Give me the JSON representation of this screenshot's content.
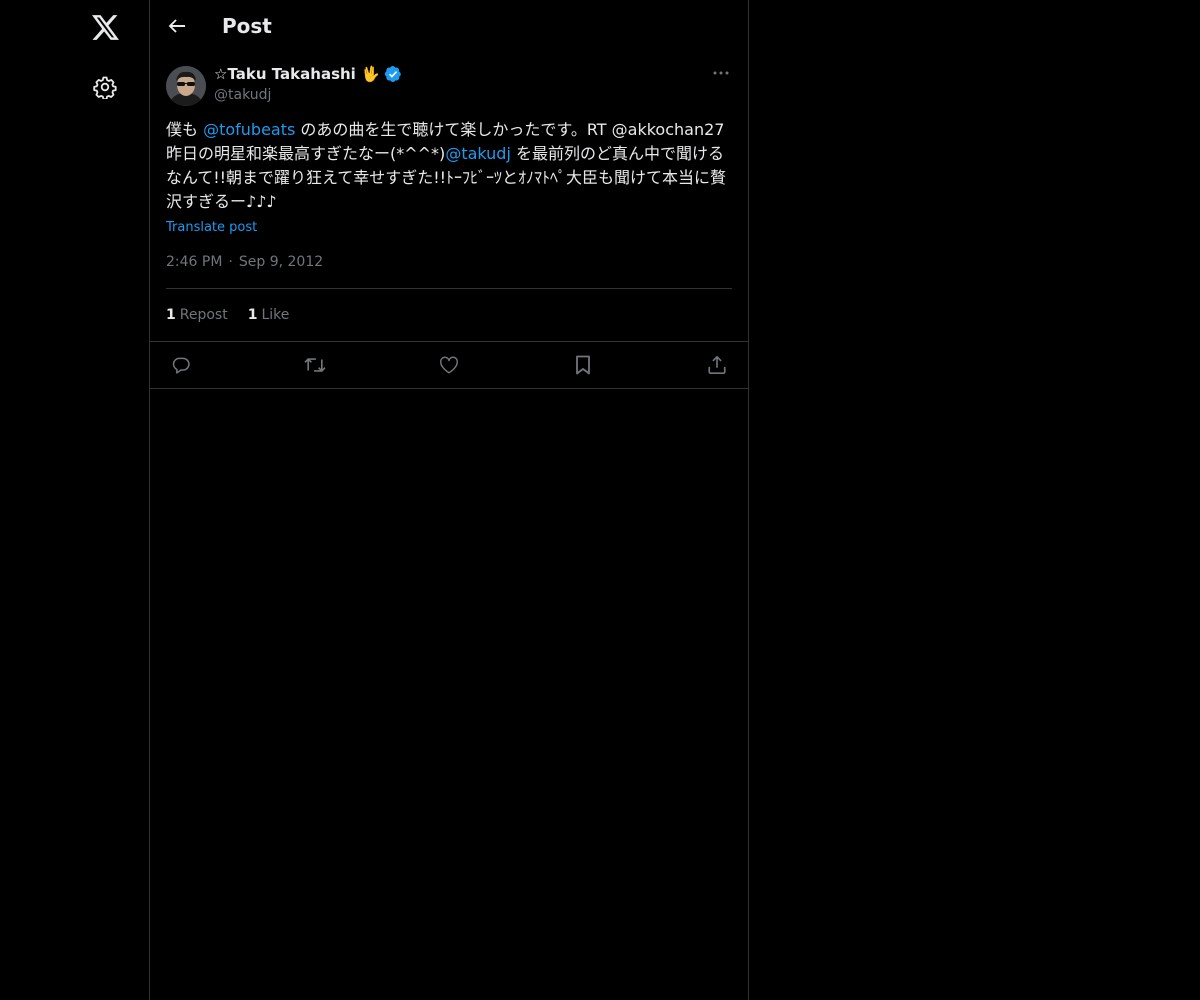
{
  "header": {
    "title": "Post"
  },
  "post": {
    "author": {
      "display_name": "☆Taku Takahashi 🖖",
      "handle": "@takudj",
      "verified": true
    },
    "text_parts": [
      {
        "type": "text",
        "value": "僕も "
      },
      {
        "type": "mention",
        "value": "@tofubeats"
      },
      {
        "type": "text",
        "value": " のあの曲を生で聴けて楽しかったです。RT @akkochan27 昨日の明星和楽最高すぎたなー(*^^*)"
      },
      {
        "type": "mention",
        "value": "@takudj"
      },
      {
        "type": "text",
        "value": " を最前列のど真ん中で聞けるなんて!!朝まで躍り狂えて幸せすぎた!!ﾄｰﾌﾋﾞｰﾂとｵﾉﾏﾄﾍﾟ大臣も聞けて本当に贅沢すぎるー♪♪♪"
      }
    ],
    "translate_label": "Translate post",
    "time": "2:46 PM",
    "date": "Sep 9, 2012",
    "stats": {
      "reposts_count": "1",
      "reposts_label": "Repost",
      "likes_count": "1",
      "likes_label": "Like"
    }
  },
  "icons": {
    "logo": "x-logo-icon",
    "settings": "gear-icon",
    "back": "back-arrow-icon",
    "more": "more-dots-icon",
    "verified": "verified-badge-icon",
    "reply": "reply-icon",
    "repost": "repost-icon",
    "like": "heart-icon",
    "bookmark": "bookmark-icon",
    "share": "share-icon"
  },
  "colors": {
    "background": "#000000",
    "text": "#e7e9ea",
    "secondary": "#71767b",
    "accent": "#1d9bf0",
    "border": "#2f3336"
  }
}
